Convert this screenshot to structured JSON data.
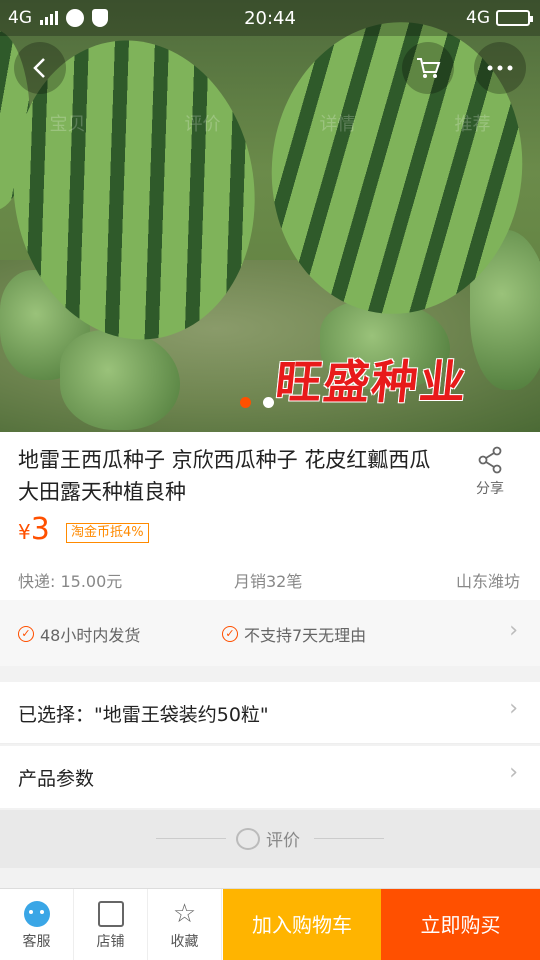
{
  "status_bar": {
    "network_left": "4G",
    "time": "20:44",
    "network_right": "4G"
  },
  "hero": {
    "watermark": "旺盛种业",
    "nav_tabs": [
      "宝贝",
      "评价",
      "详情",
      "推荐"
    ],
    "image_count": 2,
    "active_image": 1
  },
  "product": {
    "title": "地雷王西瓜种子 京欣西瓜种子 花皮红瓤西瓜 大田露天种植良种",
    "share_label": "分享",
    "price_symbol": "¥",
    "price": "3",
    "coin_badge": "淘金币抵4%",
    "shipping": "快递: 15.00元",
    "monthly_sales": "月销32笔",
    "location": "山东潍坊"
  },
  "guarantees": {
    "item1": "48小时内发货",
    "item2": "不支持7天无理由"
  },
  "selection": {
    "label": "已选择：\"地雷王袋装约50粒\""
  },
  "params": {
    "label": "产品参数"
  },
  "reviews": {
    "label": "评价"
  },
  "bottom_bar": {
    "service": "客服",
    "store": "店铺",
    "favorite": "收藏",
    "add_to_cart": "加入购物车",
    "buy_now": "立即购买"
  },
  "colors": {
    "accent": "#ff5000",
    "cart": "#ffb400",
    "coin": "#ff8a00"
  }
}
